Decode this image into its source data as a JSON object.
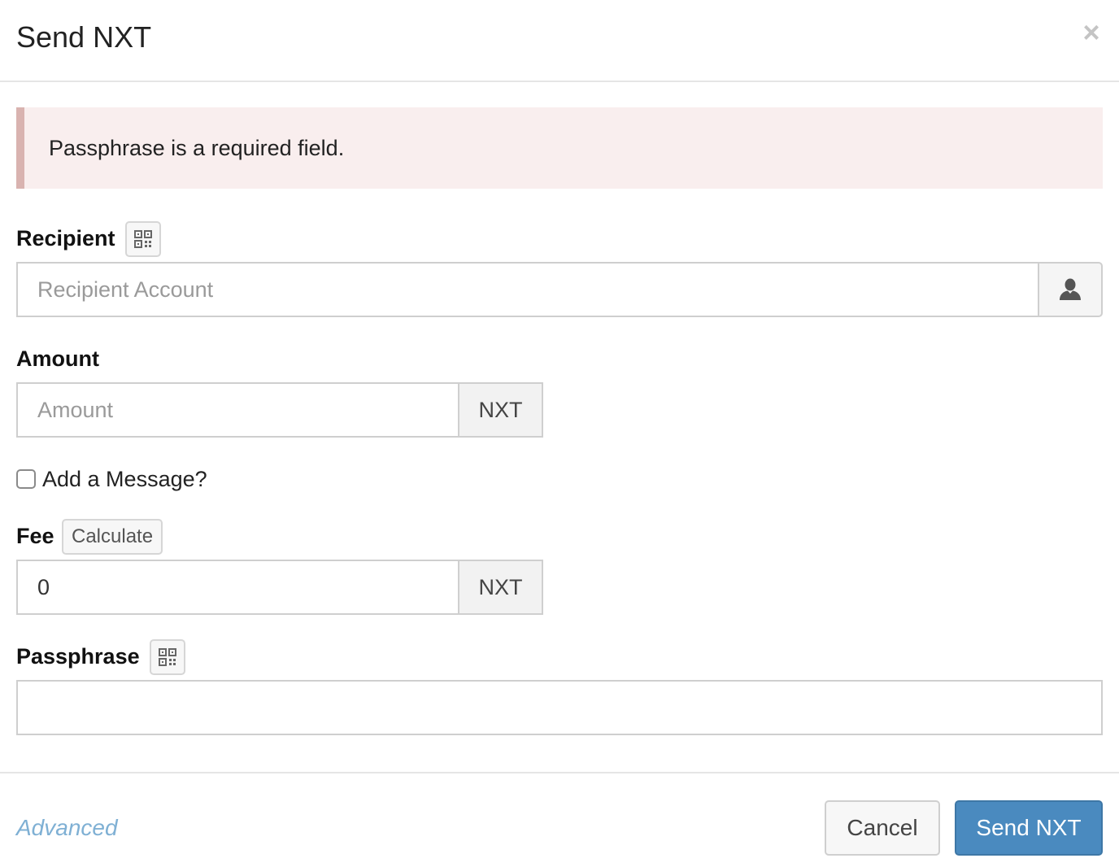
{
  "modal": {
    "title": "Send NXT",
    "close_label": "×"
  },
  "alert": {
    "message": "Passphrase is a required field."
  },
  "recipient": {
    "label": "Recipient",
    "placeholder": "Recipient Account",
    "qr_icon": "qr-code-icon",
    "addon_icon": "user-icon"
  },
  "amount": {
    "label": "Amount",
    "placeholder": "Amount",
    "unit": "NXT"
  },
  "message_option": {
    "label": "Add a Message?",
    "checked": false
  },
  "fee": {
    "label": "Fee",
    "calculate_label": "Calculate",
    "value": "0",
    "unit": "NXT"
  },
  "passphrase": {
    "label": "Passphrase",
    "value": "",
    "qr_icon": "qr-code-icon"
  },
  "footer": {
    "advanced_label": "Advanced",
    "cancel_label": "Cancel",
    "send_label": "Send NXT"
  },
  "colors": {
    "primary": "#4a8abf",
    "alert_bg": "#f9eeee",
    "alert_border": "#d9b3b0",
    "link": "#7fb0d4"
  }
}
